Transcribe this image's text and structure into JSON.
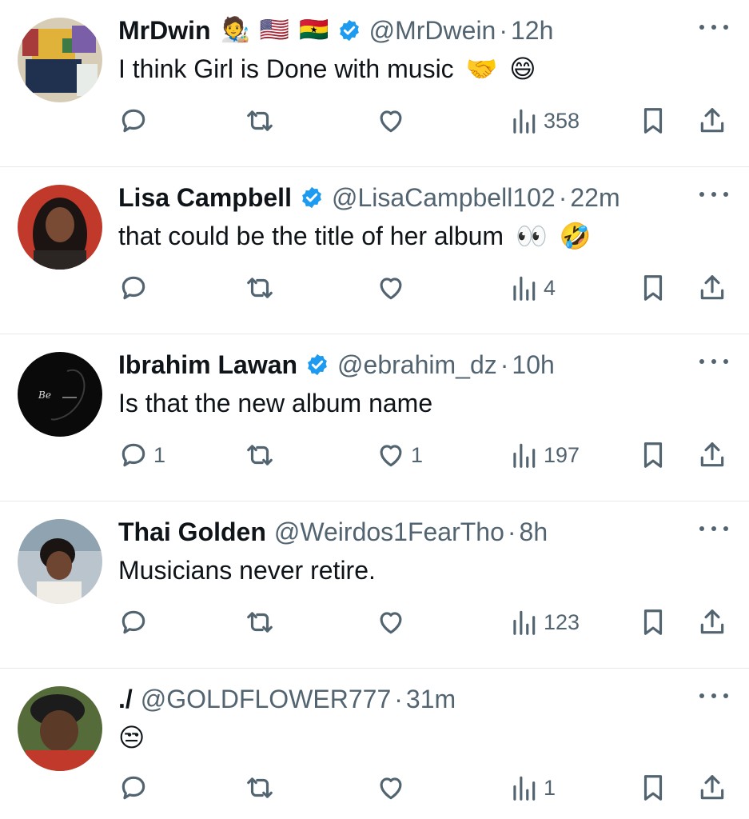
{
  "colors": {
    "text": "#0f1419",
    "muted": "#536471",
    "verified": "#1d9bf0",
    "divider": "#e7e9ea"
  },
  "tweets": [
    {
      "name": "MrDwin",
      "name_emojis": [
        "🧑‍🎨",
        "🇺🇸",
        "🇬🇭"
      ],
      "verified": true,
      "handle": "@MrDwein",
      "time": "12h",
      "text": "I think Girl is Done with music",
      "text_emojis": [
        "🤝",
        "😄"
      ],
      "replies": "",
      "retweets": "",
      "likes": "",
      "views": "358"
    },
    {
      "name": "Lisa Campbell",
      "name_emojis": [],
      "verified": true,
      "handle": "@LisaCampbell102",
      "time": "22m",
      "text": "that could be the title of her album",
      "text_emojis": [
        "👀",
        "🤣"
      ],
      "replies": "",
      "retweets": "",
      "likes": "",
      "views": "4"
    },
    {
      "name": "Ibrahim Lawan",
      "name_emojis": [],
      "verified": true,
      "handle": "@ebrahim_dz",
      "time": "10h",
      "text": "Is that the new album name",
      "text_emojis": [],
      "replies": "1",
      "retweets": "",
      "likes": "1",
      "views": "197"
    },
    {
      "name": "Thai Golden",
      "name_emojis": [],
      "verified": false,
      "handle": "@Weirdos1FearTho",
      "time": "8h",
      "text": "Musicians never retire.",
      "text_emojis": [],
      "replies": "",
      "retweets": "",
      "likes": "",
      "views": "123"
    },
    {
      "name": "./",
      "name_emojis": [],
      "verified": false,
      "handle": "@GOLDFLOWER777",
      "time": "31m",
      "text": "",
      "text_emojis": [
        "😒"
      ],
      "replies": "",
      "retweets": "",
      "likes": "",
      "views": "1"
    }
  ]
}
